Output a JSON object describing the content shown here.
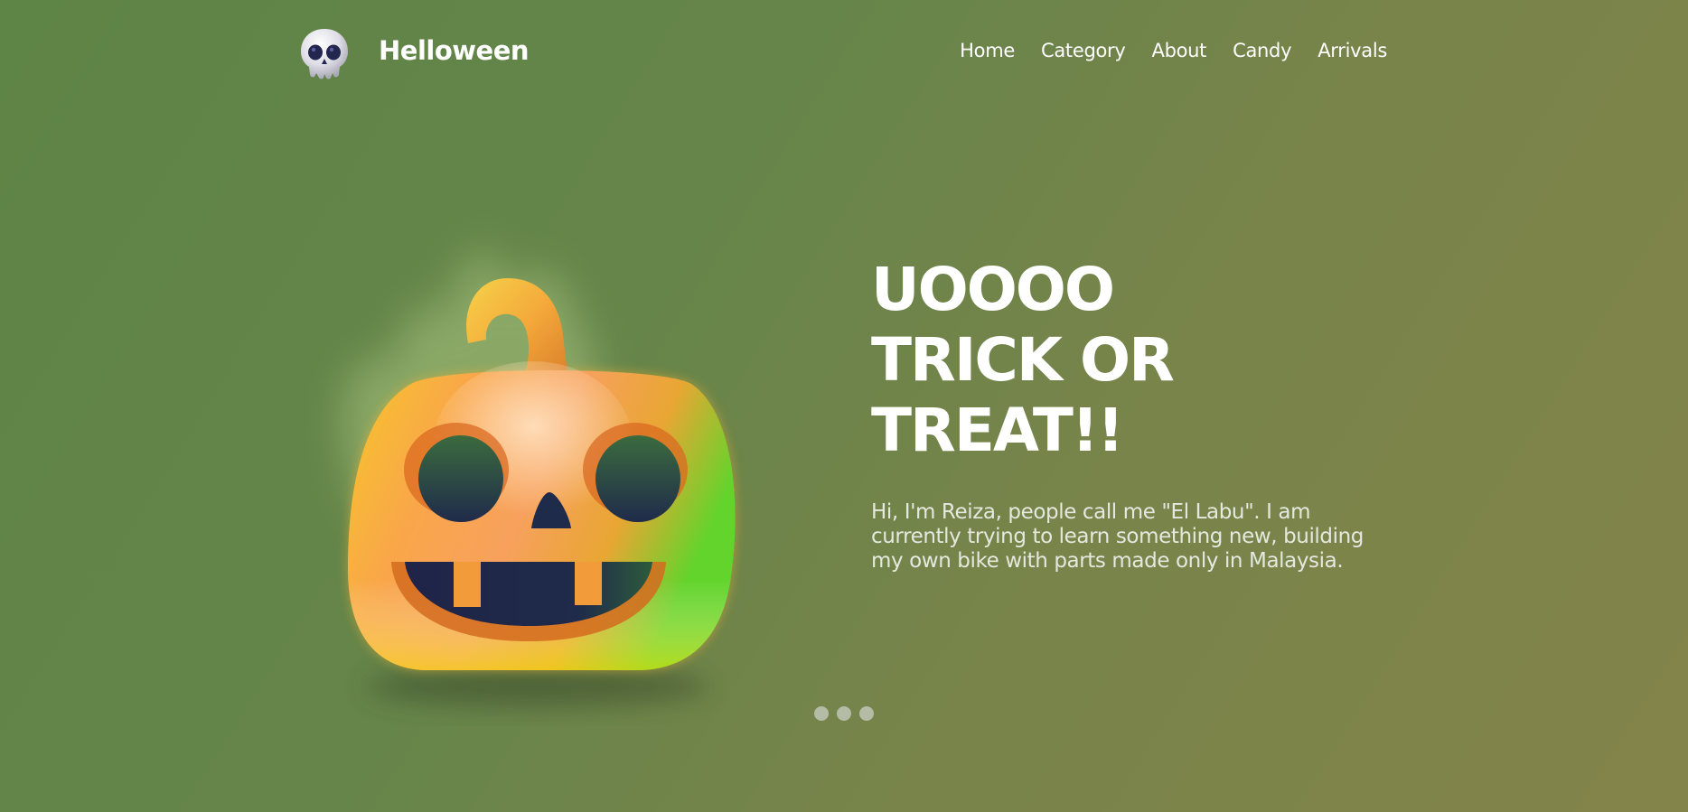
{
  "brand": {
    "name": "Helloween",
    "logo_icon": "skull-icon"
  },
  "nav": {
    "items": [
      {
        "label": "Home"
      },
      {
        "label": "Category"
      },
      {
        "label": "About"
      },
      {
        "label": "Candy"
      },
      {
        "label": "Arrivals"
      }
    ]
  },
  "hero": {
    "headline_lines": [
      "UOOOO",
      "TRICK OR",
      "TREAT!!"
    ],
    "description": "Hi, I'm Reiza, people call me \"El Labu\". I am currently trying to learn something new, building my own bike with parts made only in Malaysia.",
    "illustration": "jack-o-lantern-illustration"
  },
  "pager": {
    "count": 3
  },
  "colors": {
    "background_start": "#5e8446",
    "background_end": "#83844a",
    "text": "#ffffff",
    "description_text": "#e5e8df",
    "pumpkin_orange": "#f7931e",
    "pumpkin_yellow": "#f2e30c",
    "pumpkin_green": "#5fd42a",
    "face_dark": "#1f2b4a",
    "pager_dot": "#b4bca6"
  }
}
